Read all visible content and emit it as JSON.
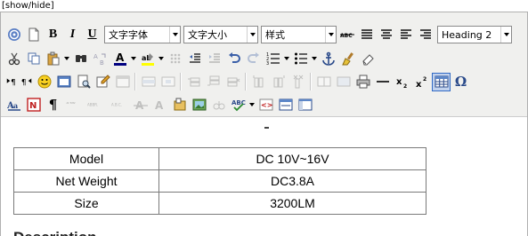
{
  "show_hide": "[show/hide]",
  "toolbar": {
    "font_family": "文字字体",
    "font_size": "文字大小",
    "style": "样式",
    "format": "Heading 2",
    "omega": "Ω"
  },
  "spec_table": {
    "rows": [
      {
        "label": "Model",
        "value": "DC 10V~16V"
      },
      {
        "label": "Net Weight",
        "value": "DC3.8A"
      },
      {
        "label": "Size",
        "value": "3200LM"
      }
    ]
  },
  "description_heading": "Description"
}
